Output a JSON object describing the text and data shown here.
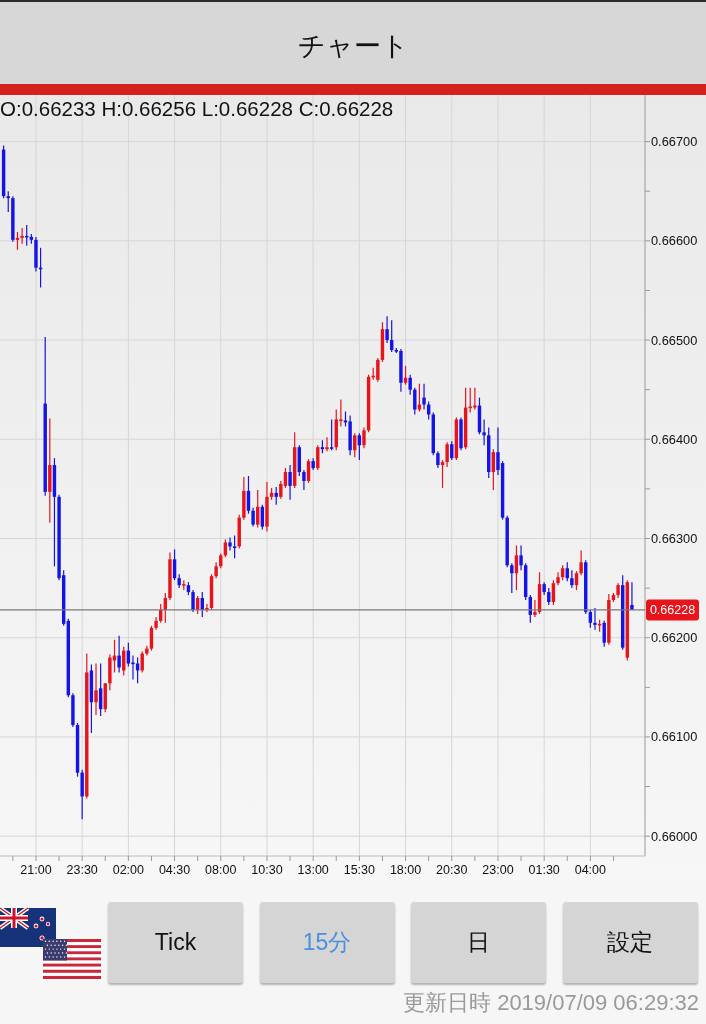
{
  "header": {
    "title": "チャート"
  },
  "chart": {
    "ohlc_readout": "O:0.66233 H:0.66256 L:0.66228 C:0.66228",
    "chart_data": {
      "type": "candlestick",
      "grid": true,
      "ylim": [
        0.6598,
        0.66747
      ],
      "ref_lines": [
        {
          "axis": "y",
          "value": 0.66228,
          "label": "0.66228"
        }
      ],
      "yticks": [
        {
          "value": 0.667,
          "label": "0.66700"
        },
        {
          "value": 0.666,
          "label": "0.66600"
        },
        {
          "value": 0.665,
          "label": "0.66500"
        },
        {
          "value": 0.664,
          "label": "0.66400"
        },
        {
          "value": 0.663,
          "label": "0.66300"
        },
        {
          "value": 0.662,
          "label": "0.66200"
        },
        {
          "value": 0.661,
          "label": "0.66100"
        },
        {
          "value": 0.66,
          "label": "0.66000"
        }
      ],
      "categories": [
        null,
        null,
        null,
        null,
        null,
        null,
        null,
        "21:00",
        null,
        null,
        null,
        null,
        null,
        null,
        null,
        null,
        null,
        "23:30",
        null,
        null,
        null,
        null,
        null,
        null,
        null,
        null,
        null,
        "02:00",
        null,
        null,
        null,
        null,
        null,
        null,
        null,
        null,
        null,
        "04:30",
        null,
        null,
        null,
        null,
        null,
        null,
        null,
        null,
        null,
        "08:00",
        null,
        null,
        null,
        null,
        null,
        null,
        null,
        null,
        null,
        "10:30",
        null,
        null,
        null,
        null,
        null,
        null,
        null,
        null,
        null,
        "13:00",
        null,
        null,
        null,
        null,
        null,
        null,
        null,
        null,
        null,
        "15:30",
        null,
        null,
        null,
        null,
        null,
        null,
        null,
        null,
        null,
        "18:00",
        null,
        null,
        null,
        null,
        null,
        null,
        null,
        null,
        null,
        "20:30",
        null,
        null,
        null,
        null,
        null,
        null,
        null,
        null,
        null,
        "23:00",
        null,
        null,
        null,
        null,
        null,
        null,
        null,
        null,
        null,
        "01:30",
        null,
        null,
        null,
        null,
        null,
        null,
        null,
        null,
        null,
        "04:00",
        null,
        null,
        null,
        null,
        null,
        null,
        null,
        null,
        null
      ],
      "ohlc": [
        [
          0.66692,
          0.66696,
          0.66643,
          0.66645
        ],
        [
          0.66645,
          0.6665,
          0.66629,
          0.66643
        ],
        [
          0.66643,
          0.66645,
          0.66599,
          0.66601
        ],
        [
          0.66601,
          0.66609,
          0.66591,
          0.66603
        ],
        [
          0.66603,
          0.66613,
          0.66597,
          0.66605
        ],
        [
          0.66605,
          0.66616,
          0.66595,
          0.66604
        ],
        [
          0.66604,
          0.66607,
          0.66597,
          0.66601
        ],
        [
          0.66601,
          0.66604,
          0.66569,
          0.66573
        ],
        [
          0.66573,
          0.66593,
          0.66553,
          0.66572
        ],
        [
          0.66436,
          0.66503,
          0.66343,
          0.66347
        ],
        [
          0.66347,
          0.66421,
          0.66316,
          0.66374
        ],
        [
          0.66374,
          0.66381,
          0.66272,
          0.66342
        ],
        [
          0.66342,
          0.66344,
          0.66258,
          0.6626
        ],
        [
          0.66263,
          0.66268,
          0.66212,
          0.66214
        ],
        [
          0.66217,
          0.66219,
          0.6614,
          0.66142
        ],
        [
          0.66142,
          0.66144,
          0.6611,
          0.66112
        ],
        [
          0.66112,
          0.66114,
          0.6606,
          0.66064
        ],
        [
          0.66064,
          0.66067,
          0.66017,
          0.6604
        ],
        [
          0.6604,
          0.66184,
          0.66038,
          0.66165
        ],
        [
          0.66167,
          0.66173,
          0.66104,
          0.66135
        ],
        [
          0.66135,
          0.66174,
          0.66122,
          0.66147
        ],
        [
          0.66149,
          0.66174,
          0.66121,
          0.66128
        ],
        [
          0.66128,
          0.66154,
          0.66125,
          0.66154
        ],
        [
          0.66154,
          0.66183,
          0.66147,
          0.6618
        ],
        [
          0.66177,
          0.66198,
          0.66165,
          0.66182
        ],
        [
          0.66182,
          0.66202,
          0.66165,
          0.6617
        ],
        [
          0.66167,
          0.66191,
          0.66162,
          0.66187
        ],
        [
          0.66187,
          0.66195,
          0.66171,
          0.66174
        ],
        [
          0.66175,
          0.66182,
          0.66158,
          0.66174
        ],
        [
          0.66174,
          0.6618,
          0.66154,
          0.66167
        ],
        [
          0.66167,
          0.66186,
          0.66165,
          0.66184
        ],
        [
          0.66184,
          0.66192,
          0.66182,
          0.66189
        ],
        [
          0.66189,
          0.66212,
          0.66187,
          0.6621
        ],
        [
          0.6621,
          0.66221,
          0.66208,
          0.66217
        ],
        [
          0.66217,
          0.66234,
          0.66215,
          0.66228
        ],
        [
          0.66228,
          0.66245,
          0.66215,
          0.6624
        ],
        [
          0.6624,
          0.66286,
          0.66238,
          0.66279
        ],
        [
          0.66279,
          0.66289,
          0.66258,
          0.6626
        ],
        [
          0.6626,
          0.66264,
          0.6625,
          0.66253
        ],
        [
          0.66253,
          0.66258,
          0.66248,
          0.66254
        ],
        [
          0.66253,
          0.66256,
          0.66243,
          0.66246
        ],
        [
          0.66246,
          0.66248,
          0.66226,
          0.66228
        ],
        [
          0.66228,
          0.66242,
          0.66224,
          0.6624
        ],
        [
          0.6624,
          0.66246,
          0.66221,
          0.66228
        ],
        [
          0.66228,
          0.66234,
          0.66226,
          0.6623
        ],
        [
          0.6623,
          0.66264,
          0.66228,
          0.66262
        ],
        [
          0.66262,
          0.66276,
          0.6626,
          0.66272
        ],
        [
          0.66272,
          0.66285,
          0.6627,
          0.66283
        ],
        [
          0.66283,
          0.66299,
          0.66281,
          0.66296
        ],
        [
          0.66296,
          0.66301,
          0.66288,
          0.66292
        ],
        [
          0.66292,
          0.66303,
          0.6628,
          0.66291
        ],
        [
          0.66292,
          0.66324,
          0.6629,
          0.66321
        ],
        [
          0.66321,
          0.66362,
          0.66319,
          0.66348
        ],
        [
          0.66348,
          0.66363,
          0.66325,
          0.66328
        ],
        [
          0.66328,
          0.66331,
          0.66312,
          0.66314
        ],
        [
          0.66314,
          0.66349,
          0.66311,
          0.66332
        ],
        [
          0.66332,
          0.66334,
          0.66309,
          0.66312
        ],
        [
          0.66312,
          0.66357,
          0.66307,
          0.66342
        ],
        [
          0.66342,
          0.66351,
          0.66339,
          0.66346
        ],
        [
          0.66346,
          0.66352,
          0.66334,
          0.66342
        ],
        [
          0.66342,
          0.66358,
          0.6634,
          0.66355
        ],
        [
          0.66353,
          0.66371,
          0.66351,
          0.66367
        ],
        [
          0.66367,
          0.66374,
          0.66339,
          0.66353
        ],
        [
          0.66353,
          0.66407,
          0.66351,
          0.66392
        ],
        [
          0.66392,
          0.66394,
          0.66363,
          0.66367
        ],
        [
          0.66367,
          0.66369,
          0.66349,
          0.66358
        ],
        [
          0.66358,
          0.6638,
          0.66356,
          0.66378
        ],
        [
          0.66378,
          0.66381,
          0.66369,
          0.66371
        ],
        [
          0.66371,
          0.66394,
          0.66369,
          0.66392
        ],
        [
          0.66392,
          0.66399,
          0.66386,
          0.6639
        ],
        [
          0.6639,
          0.66402,
          0.66388,
          0.66392
        ],
        [
          0.66392,
          0.6642,
          0.66389,
          0.66391
        ],
        [
          0.66392,
          0.6643,
          0.66389,
          0.6642
        ],
        [
          0.6642,
          0.6644,
          0.66413,
          0.6642
        ],
        [
          0.66419,
          0.66428,
          0.66413,
          0.66417
        ],
        [
          0.66418,
          0.66424,
          0.66384,
          0.66389
        ],
        [
          0.66389,
          0.66406,
          0.66382,
          0.66404
        ],
        [
          0.66404,
          0.66406,
          0.66379,
          0.66394
        ],
        [
          0.66394,
          0.66412,
          0.66391,
          0.66409
        ],
        [
          0.66409,
          0.66465,
          0.66407,
          0.66463
        ],
        [
          0.66463,
          0.66472,
          0.6646,
          0.66464
        ],
        [
          0.6646,
          0.66482,
          0.66458,
          0.6648
        ],
        [
          0.6648,
          0.66518,
          0.66478,
          0.66511
        ],
        [
          0.66511,
          0.66524,
          0.66497,
          0.665
        ],
        [
          0.665,
          0.6652,
          0.66488,
          0.6649
        ],
        [
          0.6649,
          0.66492,
          0.66487,
          0.66489
        ],
        [
          0.66489,
          0.66491,
          0.66448,
          0.66457
        ],
        [
          0.66457,
          0.66474,
          0.66455,
          0.66462
        ],
        [
          0.66462,
          0.66465,
          0.66445,
          0.6645
        ],
        [
          0.6645,
          0.66452,
          0.66425,
          0.6643
        ],
        [
          0.6643,
          0.66456,
          0.66428,
          0.66435
        ],
        [
          0.66442,
          0.66456,
          0.6643,
          0.66435
        ],
        [
          0.66435,
          0.66438,
          0.6642,
          0.66425
        ],
        [
          0.66425,
          0.66427,
          0.66384,
          0.66386
        ],
        [
          0.66386,
          0.66388,
          0.66371,
          0.66374
        ],
        [
          0.66374,
          0.66379,
          0.66351,
          0.66377
        ],
        [
          0.66377,
          0.66397,
          0.66372,
          0.66395
        ],
        [
          0.66395,
          0.66398,
          0.66379,
          0.66381
        ],
        [
          0.66381,
          0.66422,
          0.66379,
          0.6642
        ],
        [
          0.6642,
          0.66422,
          0.66389,
          0.66391
        ],
        [
          0.66392,
          0.66452,
          0.6639,
          0.66432
        ],
        [
          0.66432,
          0.66452,
          0.66427,
          0.66433
        ],
        [
          0.66432,
          0.66452,
          0.6643,
          0.66434
        ],
        [
          0.66434,
          0.66442,
          0.66405,
          0.66407
        ],
        [
          0.66407,
          0.6642,
          0.66394,
          0.66404
        ],
        [
          0.66404,
          0.66412,
          0.66361,
          0.66367
        ],
        [
          0.66367,
          0.6639,
          0.66349,
          0.66387
        ],
        [
          0.66387,
          0.66412,
          0.66364,
          0.66369
        ],
        [
          0.66376,
          0.66378,
          0.66319,
          0.66321
        ],
        [
          0.66321,
          0.66323,
          0.66271,
          0.66273
        ],
        [
          0.66273,
          0.66275,
          0.66245,
          0.66265
        ],
        [
          0.66265,
          0.66293,
          0.66248,
          0.66283
        ],
        [
          0.66283,
          0.66293,
          0.66268,
          0.66273
        ],
        [
          0.66273,
          0.66275,
          0.66238,
          0.66241
        ],
        [
          0.66241,
          0.66243,
          0.66215,
          0.66223
        ],
        [
          0.66223,
          0.66238,
          0.66221,
          0.66226
        ],
        [
          0.66226,
          0.66266,
          0.66224,
          0.66254
        ],
        [
          0.66254,
          0.66256,
          0.66243,
          0.66246
        ],
        [
          0.66246,
          0.6625,
          0.66233,
          0.66236
        ],
        [
          0.66236,
          0.66258,
          0.66233,
          0.66255
        ],
        [
          0.66255,
          0.66266,
          0.66253,
          0.66261
        ],
        [
          0.66261,
          0.66273,
          0.66258,
          0.6627
        ],
        [
          0.6627,
          0.66276,
          0.66257,
          0.6626
        ],
        [
          0.6626,
          0.66268,
          0.6625,
          0.66253
        ],
        [
          0.66253,
          0.66267,
          0.66248,
          0.66265
        ],
        [
          0.66265,
          0.66288,
          0.66263,
          0.66276
        ],
        [
          0.66276,
          0.66278,
          0.66224,
          0.66226
        ],
        [
          0.66226,
          0.66228,
          0.6621,
          0.66215
        ],
        [
          0.66215,
          0.6623,
          0.66208,
          0.66213
        ],
        [
          0.66213,
          0.66218,
          0.66206,
          0.66214
        ],
        [
          0.66215,
          0.66217,
          0.66191,
          0.66195
        ],
        [
          0.66195,
          0.66244,
          0.66193,
          0.66238
        ],
        [
          0.66238,
          0.66245,
          0.66236,
          0.66243
        ],
        [
          0.66243,
          0.66255,
          0.6624,
          0.66253
        ],
        [
          0.66253,
          0.66263,
          0.66188,
          0.6619
        ],
        [
          0.6618,
          0.66258,
          0.66177,
          0.66256
        ],
        [
          0.66233,
          0.66256,
          0.66228,
          0.66228
        ]
      ]
    }
  },
  "buttons": [
    {
      "label": "Tick",
      "selected": false
    },
    {
      "label": "15分",
      "selected": true
    },
    {
      "label": "日",
      "selected": false
    },
    {
      "label": "設定",
      "selected": false
    }
  ],
  "footer": {
    "last_updated": "更新日時 2019/07/09 06:29:32"
  }
}
